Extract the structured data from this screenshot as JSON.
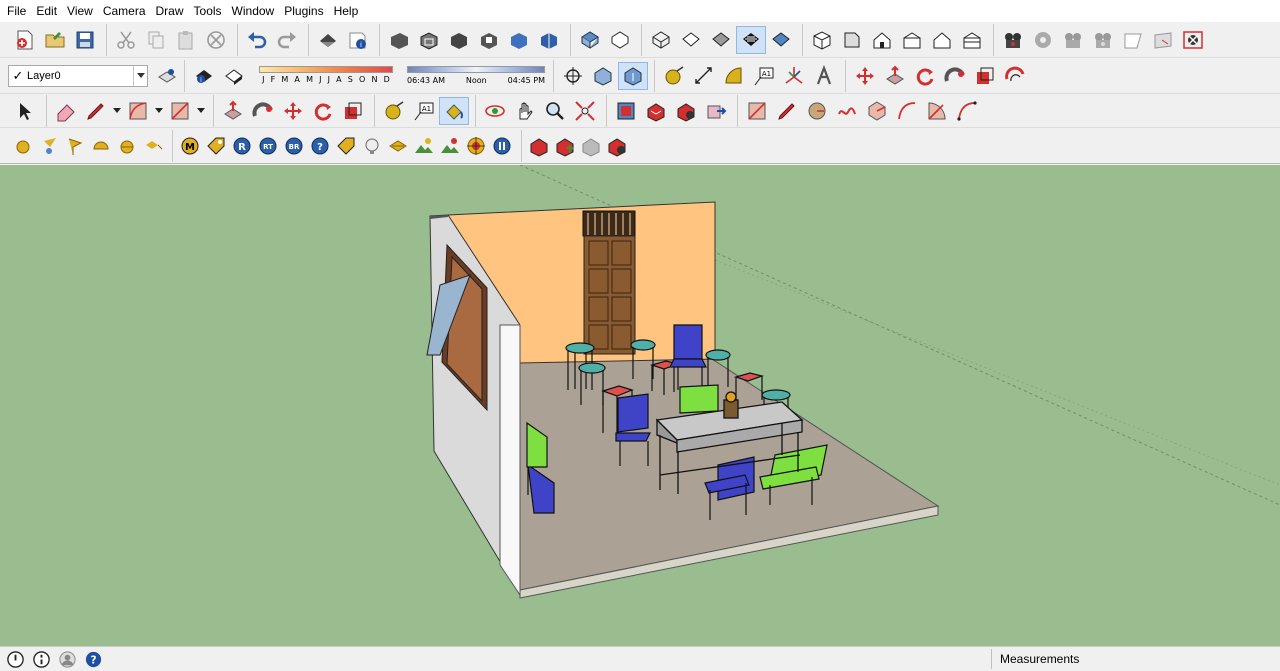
{
  "menu": [
    "File",
    "Edit",
    "View",
    "Camera",
    "Draw",
    "Tools",
    "Window",
    "Plugins",
    "Help"
  ],
  "layer": {
    "current": "Layer0",
    "visible_check": "✓"
  },
  "shadow": {
    "months": [
      "J",
      "F",
      "M",
      "A",
      "M",
      "J",
      "J",
      "A",
      "S",
      "O",
      "N",
      "D"
    ],
    "time_start": "06:43 AM",
    "time_mid": "Noon",
    "time_end": "04:45 PM"
  },
  "status": {
    "measurements_label": "Measurements"
  },
  "colors": {
    "viewport_bg": "#99bd8e",
    "accent_red": "#d42f2f",
    "active_tool": "#cfe2f7"
  }
}
